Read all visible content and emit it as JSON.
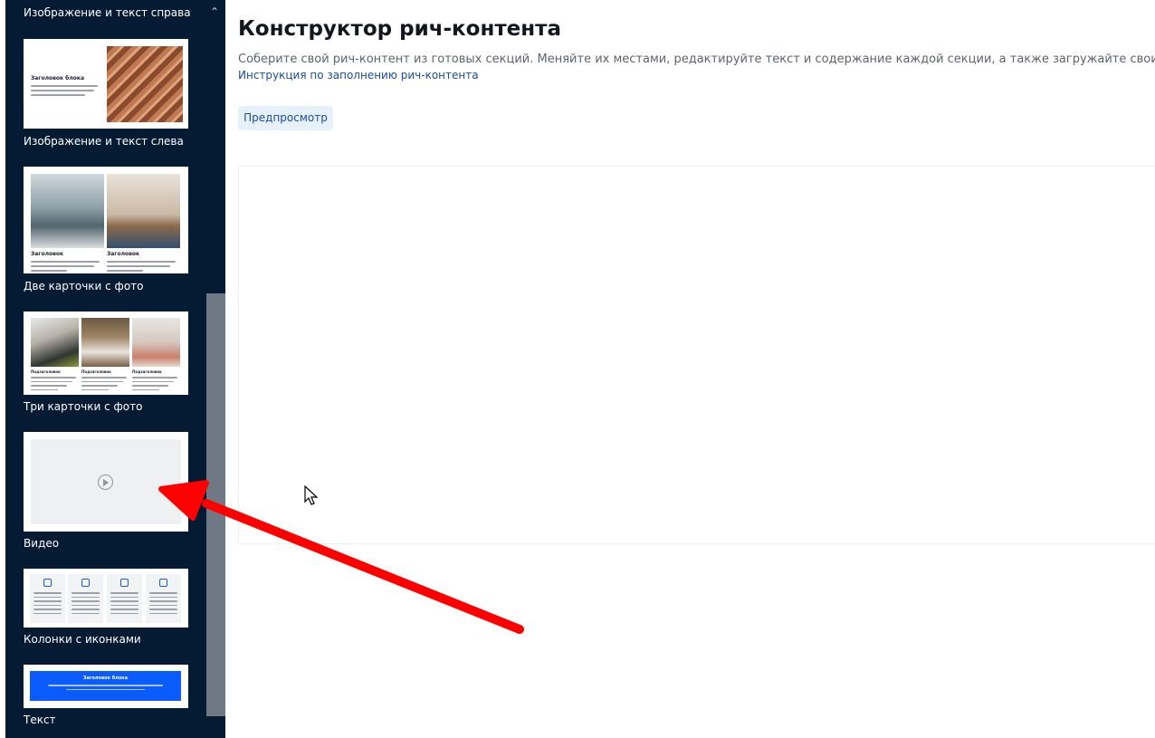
{
  "sidebar": {
    "header_label": "Изображение и текст справа",
    "cards": [
      {
        "label": "Изображение и текст слева",
        "preview_title": "Заголовок блока"
      },
      {
        "label": "Две карточки с фото",
        "preview_titles": [
          "Заголовок",
          "Заголовок"
        ]
      },
      {
        "label": "Три карточки с фото",
        "preview_titles": [
          "Подзаголовок",
          "Подзаголовок",
          "Подзаголовок"
        ]
      },
      {
        "label": "Видео",
        "icon": "play-icon"
      },
      {
        "label": "Колонки с иконками",
        "icon": "image-icon"
      },
      {
        "label": "Текст",
        "preview_title": "Заголовок блока"
      }
    ],
    "colors": {
      "background": "#041b33",
      "scroll_thumb": "#6f7985"
    }
  },
  "main": {
    "title": "Конструктор рич-контента",
    "subtitle": "Соберите свой рич-контент из готовых секций. Меняйте их местами, редактируйте текст и содержание каждой секции, а также загружайте свои фото.",
    "guide_link": "Инструкция по заполнению рич-контента",
    "preview_button": "Предпросмотр"
  },
  "annotation": {
    "type": "red-arrow",
    "color": "#ff0000"
  }
}
